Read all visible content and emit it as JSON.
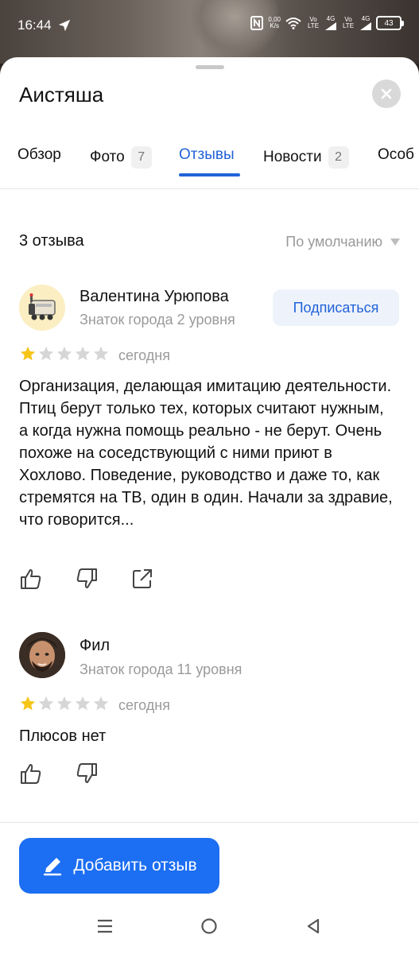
{
  "status_bar": {
    "time": "16:44",
    "net_speed_top": "0,00",
    "net_speed_bottom": "K/s",
    "sim1": "Vo LTE",
    "sim1_gen": "4G",
    "sim2": "Vo LTE",
    "sim2_gen": "4G",
    "battery": "43"
  },
  "header": {
    "title": "Аистяша"
  },
  "tabs": [
    {
      "label": "Обзор",
      "count": ""
    },
    {
      "label": "Фото",
      "count": "7"
    },
    {
      "label": "Отзывы",
      "count": ""
    },
    {
      "label": "Новости",
      "count": "2"
    },
    {
      "label": "Особ",
      "count": ""
    }
  ],
  "active_tab": "Отзывы",
  "reviews_header": {
    "count_label": "3 отзыва",
    "sort_label": "По умолчанию"
  },
  "reviews": [
    {
      "author": "Валентина Урюпова",
      "level": "Знаток города 2 уровня",
      "subscribe_label": "Подписаться",
      "rating": 1,
      "date": "сегодня",
      "text": "Организация, делающая имитацию деятельности. Птиц берут только тех, которых считают нужным, а когда нужна помощь реально - не берут. Очень похоже на соседствующий с ними приют в Хохлово. Поведение, руководство и даже то, как стремятся на ТВ, один в один. Начали за здравие, что говорится..."
    },
    {
      "author": "Фил",
      "level": "Знаток города 11 уровня",
      "rating": 1,
      "date": "сегодня",
      "text": "Плюсов нет"
    }
  ],
  "add_review_label": "Добавить отзыв",
  "colors": {
    "accent": "#2162d8",
    "button": "#1c6ef2",
    "star_filled": "#f5c518",
    "star_empty": "#d6d6d6"
  }
}
